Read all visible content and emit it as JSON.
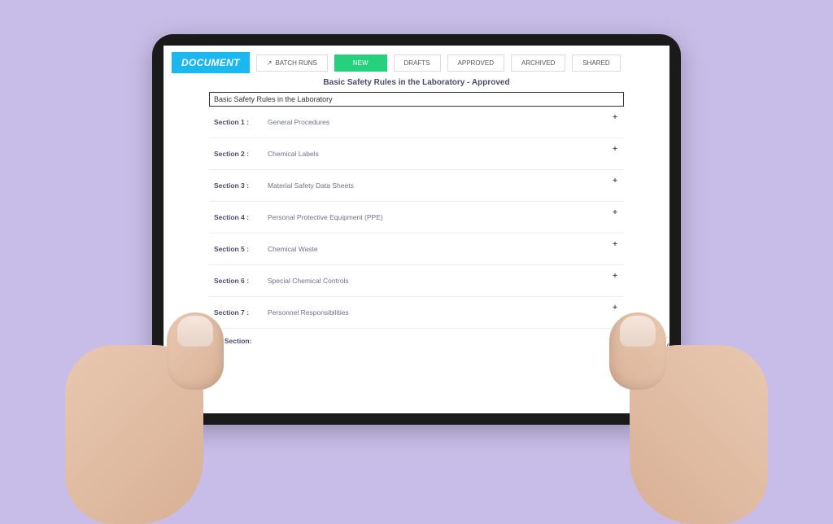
{
  "badge": "DOCUMENT",
  "tabs": {
    "batch_runs": "BATCH RUNS",
    "new": "NEW",
    "drafts": "DRAFTS",
    "approved": "APPROVED",
    "archived": "ARCHIVED",
    "shared": "SHARED"
  },
  "page_title": "Basic Safety Rules in the Laboratory - Approved",
  "title_input": "Basic Safety Rules in the Laboratory",
  "sections": [
    {
      "label": "Section 1 :",
      "name": "General Procedures"
    },
    {
      "label": "Section 2 :",
      "name": "Chemical Labels"
    },
    {
      "label": "Section 3 :",
      "name": "Material Safety Data Sheets"
    },
    {
      "label": "Section 4 :",
      "name": "Personal Protective Equipment (PPE)"
    },
    {
      "label": "Section 5 :",
      "name": "Chemical Waste"
    },
    {
      "label": "Section 6 :",
      "name": "Special Chemical Controls"
    },
    {
      "label": "Section 7 :",
      "name": "Personnel Responsibilities"
    }
  ],
  "add_section_label": "Add Section:",
  "expand": "+",
  "side_button": "LAU"
}
